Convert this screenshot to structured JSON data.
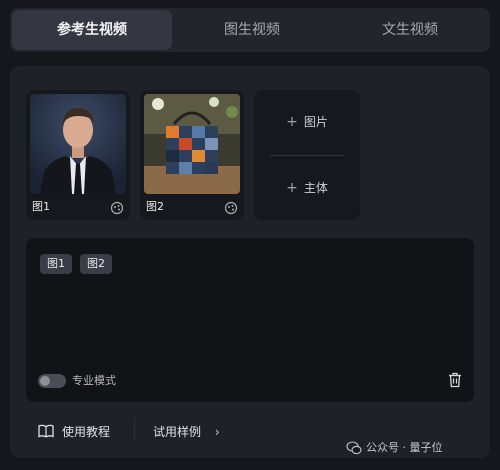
{
  "tabs": [
    {
      "label": "参考生视频",
      "active": true
    },
    {
      "label": "图生视频",
      "active": false
    },
    {
      "label": "文生视频",
      "active": false
    }
  ],
  "references": [
    {
      "caption": "图1",
      "icon": "style-icon"
    },
    {
      "caption": "图2",
      "icon": "style-icon"
    }
  ],
  "add": {
    "image_label": "图片",
    "subject_label": "主体"
  },
  "prompt": {
    "chips": [
      "图1",
      "图2"
    ],
    "pro_mode_label": "专业模式",
    "pro_mode_on": false
  },
  "footer": {
    "tutorial_label": "使用教程",
    "examples_label": "试用样例"
  },
  "watermark": "公众号 · 量子位",
  "colors": {
    "background": "#15171c",
    "panel": "#1e2127",
    "active_tab": "#343741",
    "chip": "#3a3d45"
  }
}
